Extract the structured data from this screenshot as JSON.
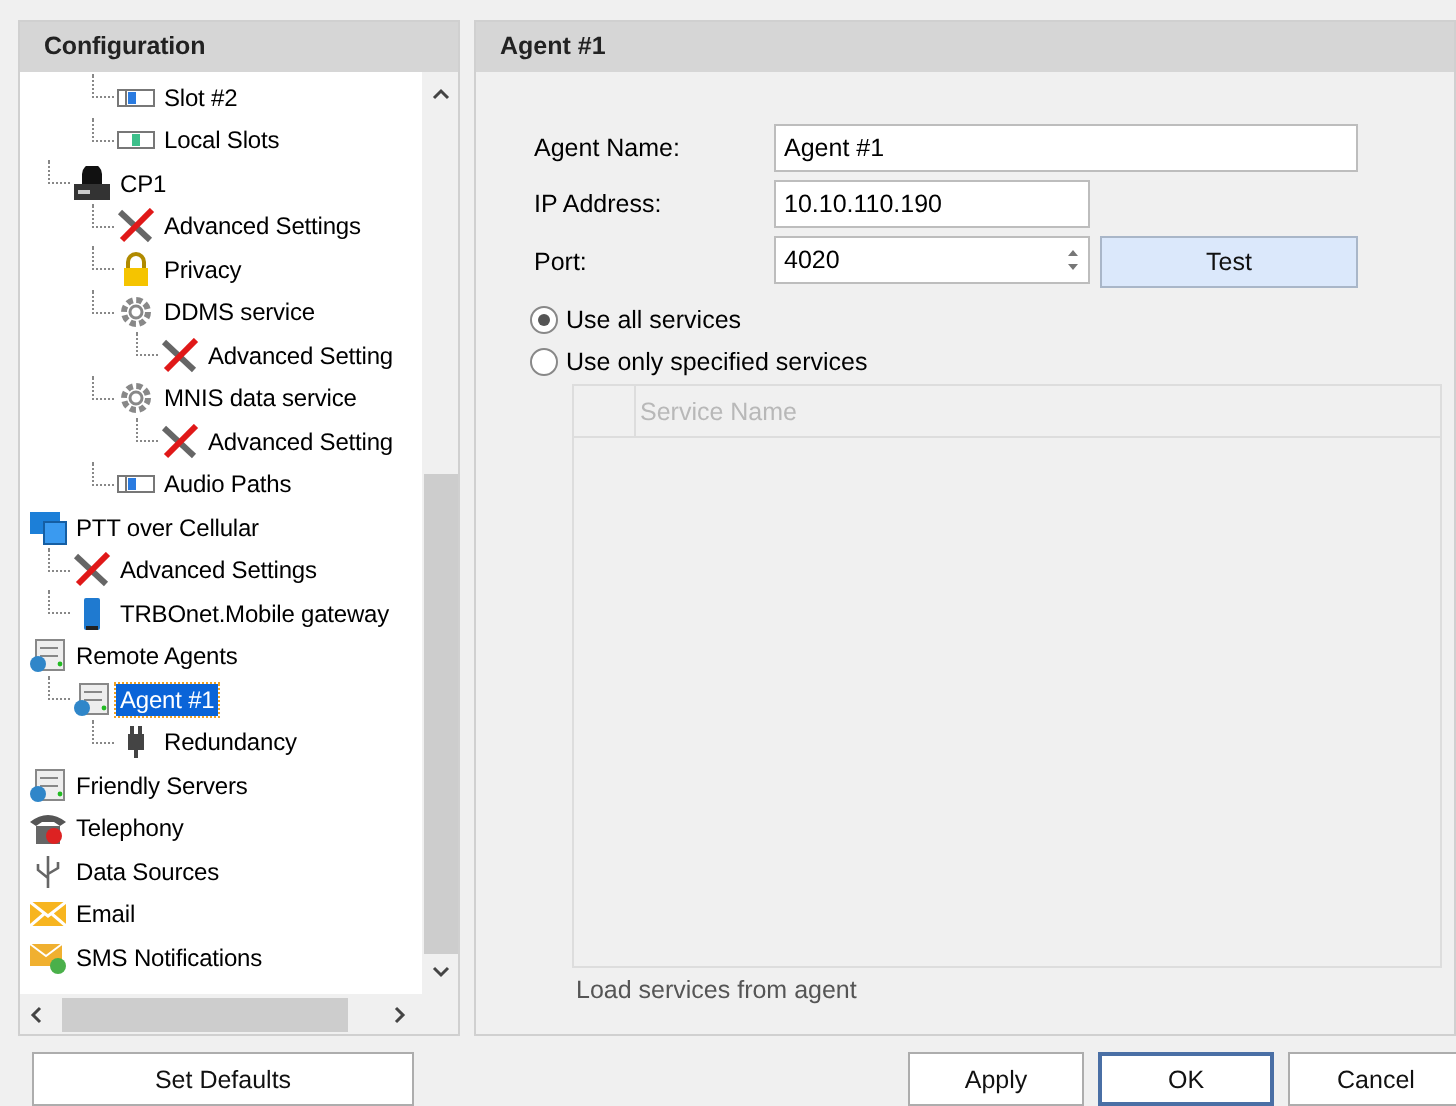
{
  "sidebar": {
    "title": "Configuration",
    "tree": [
      {
        "children": [
          {
            "children": [
              {
                "label": "Slot #2",
                "kind": "slot",
                "selected": false
              },
              {
                "label": "Local Slots",
                "kind": "localslot",
                "selected": false
              }
            ]
          },
          {
            "label": "CP1",
            "kind": "radio",
            "selected": false,
            "children": [
              {
                "label": "Advanced Settings",
                "kind": "tools",
                "selected": false
              },
              {
                "label": "Privacy",
                "kind": "lock",
                "selected": false
              },
              {
                "label": "DDMS service",
                "kind": "gear",
                "selected": false,
                "children": [
                  {
                    "label": "Advanced Setting",
                    "kind": "tools",
                    "selected": false
                  }
                ]
              },
              {
                "label": "MNIS data service",
                "kind": "gear",
                "selected": false,
                "children": [
                  {
                    "label": "Advanced Setting",
                    "kind": "tools",
                    "selected": false
                  }
                ]
              },
              {
                "label": "Audio Paths",
                "kind": "slot",
                "selected": false
              }
            ]
          }
        ]
      },
      {
        "label": "PTT over Cellular",
        "kind": "monitor",
        "selected": false,
        "children": [
          {
            "label": "Advanced Settings",
            "kind": "tools",
            "selected": false
          },
          {
            "label": "TRBOnet.Mobile gateway",
            "kind": "phone",
            "selected": false
          }
        ]
      },
      {
        "label": "Remote Agents",
        "kind": "server",
        "selected": false,
        "children": [
          {
            "label": "Agent #1",
            "kind": "server",
            "selected": true,
            "children": [
              {
                "label": "Redundancy",
                "kind": "plug",
                "selected": false
              }
            ]
          }
        ]
      },
      {
        "label": "Friendly Servers",
        "kind": "server",
        "selected": false
      },
      {
        "label": "Telephony",
        "kind": "telephone",
        "selected": false
      },
      {
        "label": "Data Sources",
        "kind": "usb",
        "selected": false
      },
      {
        "label": "Email",
        "kind": "mail",
        "selected": false
      },
      {
        "label": "SMS Notifications",
        "kind": "sms",
        "selected": false
      }
    ],
    "set_defaults": "Set Defaults"
  },
  "panel": {
    "title": "Agent #1",
    "fields": [
      {
        "label": "Agent Name:",
        "value": "Agent #1",
        "kind": "text"
      },
      {
        "label": "IP Address:",
        "value": "10.10.110.190",
        "kind": "text"
      },
      {
        "label": "Port:",
        "value": "4020",
        "kind": "spin"
      }
    ],
    "test_button": "Test",
    "options": [
      {
        "label": "Use all services",
        "selected": true
      },
      {
        "label": "Use only specified services",
        "selected": false
      }
    ],
    "service_table": {
      "columns": [
        "Service Name"
      ],
      "disabled": true
    },
    "load_link": {
      "label": "Load services from agent",
      "disabled": true
    }
  },
  "buttons": [
    {
      "label": "Apply",
      "default": false
    },
    {
      "label": "OK",
      "default": true
    },
    {
      "label": "Cancel",
      "default": false
    }
  ]
}
